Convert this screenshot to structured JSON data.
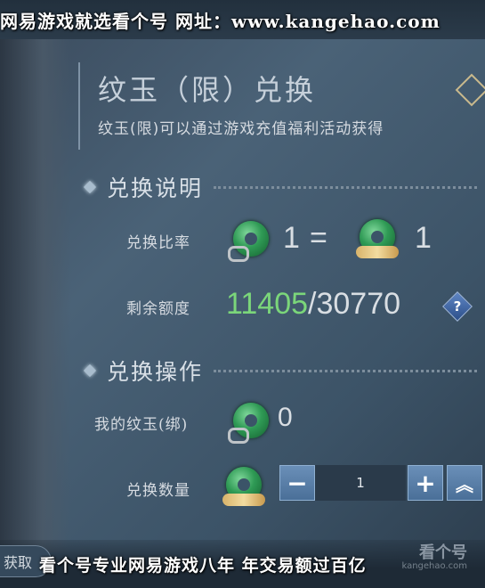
{
  "watermark_top": "网易游戏就选看个号  网址：www.kangehao.com",
  "watermark_bottom": "看个号专业网易游戏八年  年交易额过百亿",
  "watermark_logo": "看个号",
  "watermark_logo_url": "kangehao.com",
  "panel": {
    "title": "纹玉（限）兑换",
    "subtitle": "纹玉(限)可以通过游戏充值福利活动获得"
  },
  "section_info": {
    "heading": "兑换说明",
    "ratio_label": "兑换比率",
    "ratio_left": "1",
    "ratio_eq": "=",
    "ratio_right": "1",
    "quota_label": "剩余额度",
    "quota_used": "11405",
    "quota_total": "/30770",
    "help_symbol": "?"
  },
  "section_op": {
    "heading": "兑换操作",
    "my_jade_label": "我的纹玉(绑)",
    "my_jade_value": "0",
    "qty_label": "兑换数量",
    "qty_value": "1",
    "minus_symbol": "−",
    "plus_symbol": "+",
    "max_symbol": "︽"
  },
  "obtain_button": "获取",
  "icons": {
    "jade_bound": "jade-bound-icon",
    "jade_gold": "jade-gold-icon",
    "help": "help-icon",
    "diamond": "diamond-ornament-icon"
  },
  "colors": {
    "quota_green": "#7bd67a",
    "stepper_blue": "#5a80aa"
  }
}
